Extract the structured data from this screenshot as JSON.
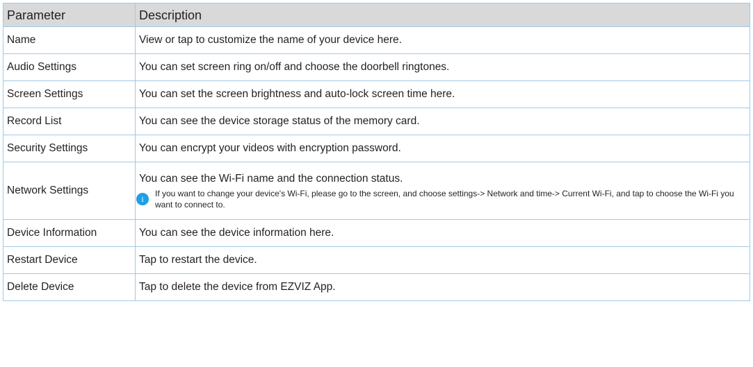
{
  "table": {
    "headers": {
      "parameter": "Parameter",
      "description": "Description"
    },
    "rows": [
      {
        "parameter": "Name",
        "description": "View or tap to customize the name of your device here."
      },
      {
        "parameter": "Audio Settings",
        "description": "You can set screen ring on/off and choose the doorbell ringtones."
      },
      {
        "parameter": "Screen Settings",
        "description": "You can set the screen brightness and auto-lock screen time here."
      },
      {
        "parameter": "Record List",
        "description": "You can see the device storage status of the memory card."
      },
      {
        "parameter": "Security Settings",
        "description": "You can encrypt your videos with encryption password."
      },
      {
        "parameter": "Network Settings",
        "description": "You can see the Wi-Fi name and the connection status.",
        "note": "If you want to change your device's Wi-Fi, please go to the screen, and choose settings-> Network and time-> Current Wi-Fi, and tap to choose the Wi-Fi you want to connect to.",
        "note_icon": "info-icon"
      },
      {
        "parameter": "Device Information",
        "description": "You can see the device information here."
      },
      {
        "parameter": "Restart Device",
        "description": "Tap to restart the device."
      },
      {
        "parameter": "Delete Device",
        "description": "Tap to delete the device from EZVIZ App."
      }
    ]
  },
  "colors": {
    "header_background": "#d9d9d9",
    "border": "#9fc9e6",
    "info_icon": "#1ea0e6",
    "text": "#231f20"
  }
}
